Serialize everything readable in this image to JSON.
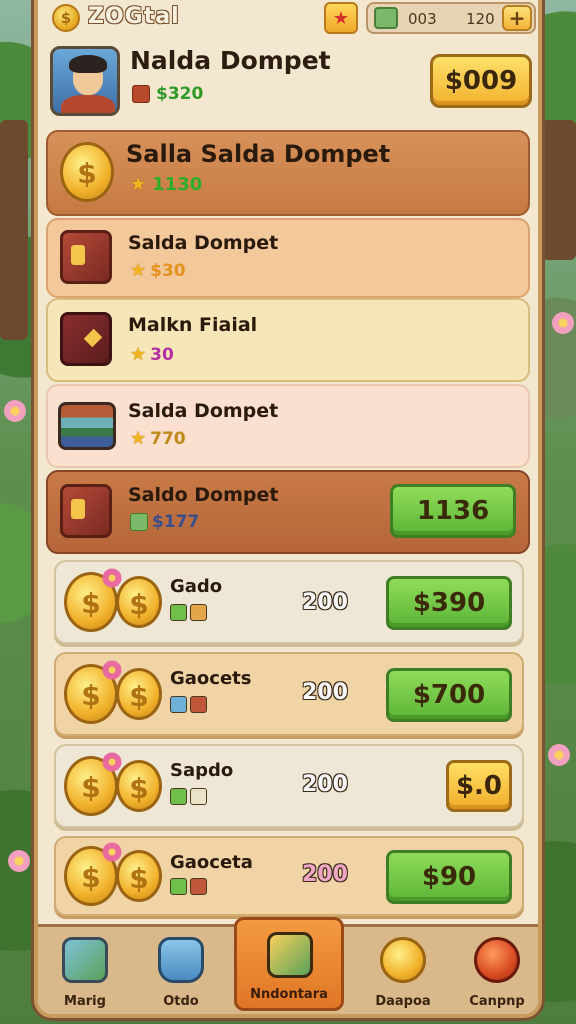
{
  "header": {
    "logo_text": "ZOGtal",
    "currency_a": "003",
    "currency_b": "120",
    "plus_label": "+"
  },
  "profile": {
    "name": "Nalda Dompet",
    "sub_value": "$320",
    "price": "$009"
  },
  "featured": {
    "title": "Salla Salda Dompet",
    "value": "1130"
  },
  "items": [
    {
      "title": "Salda Dompet",
      "value": "$30"
    },
    {
      "title": "Malkn Fiaial",
      "value": "30"
    },
    {
      "title": "Salda Dompet",
      "value": "770"
    }
  ],
  "highlight": {
    "title": "Saldo Dompet",
    "value": "$177",
    "button": "1136"
  },
  "coin_offers": [
    {
      "title": "Gado",
      "qty": "200",
      "price": "$390",
      "style": "green"
    },
    {
      "title": "Gaocets",
      "qty": "200",
      "price": "$700",
      "style": "green"
    },
    {
      "title": "Sapdo",
      "qty": "200",
      "price": "$.0",
      "style": "yellow"
    },
    {
      "title": "Gaoceta",
      "qty": "200",
      "price": "$90",
      "style": "green"
    }
  ],
  "nav": [
    {
      "label": "Marig",
      "icon": "map-icon"
    },
    {
      "label": "Otdo",
      "icon": "trash-bag-icon"
    },
    {
      "label": "Nndontara",
      "icon": "cards-icon"
    },
    {
      "label": "Daapoa",
      "icon": "coin-icon"
    },
    {
      "label": "Canpnp",
      "icon": "red-coin-icon"
    }
  ],
  "colors": {
    "panel": "#f3e7cf",
    "green_button": "#5cb436",
    "yellow_button": "#f2b22e",
    "active_nav": "#e07625"
  }
}
